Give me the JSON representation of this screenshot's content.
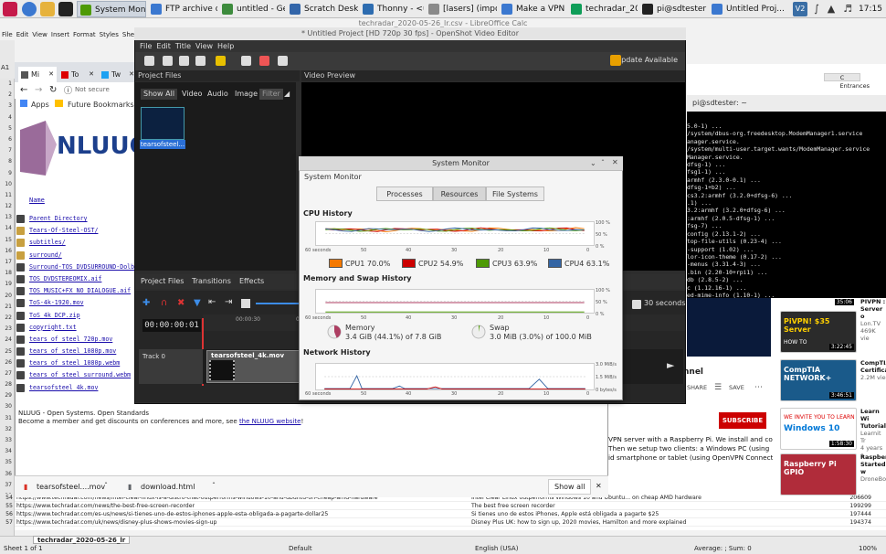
{
  "taskbar": {
    "tasks": [
      {
        "label": "System Monitor",
        "active": true
      },
      {
        "label": "FTP archive di..."
      },
      {
        "label": "untitled - Geany"
      },
      {
        "label": "Scratch Deskt..."
      },
      {
        "label": "Thonny - <un..."
      },
      {
        "label": "[lasers] (impor..."
      },
      {
        "label": "Make a VPN S..."
      },
      {
        "label": "techradar_202..."
      },
      {
        "label": "pi@sdtester: ~"
      },
      {
        "label": "Untitled Proj..."
      }
    ],
    "clock": "17:15"
  },
  "calc": {
    "title": "techradar_2020-05-26_lr.csv - LibreOffice Calc",
    "menu": [
      "File",
      "Edit",
      "View",
      "Insert",
      "Format",
      "Styles",
      "Sheet"
    ],
    "cell_ref": "A1",
    "row_numbers": [
      "1",
      "2",
      "3",
      "4",
      "5",
      "6",
      "7",
      "8",
      "9",
      "10",
      "11",
      "12",
      "13",
      "14",
      "15",
      "16",
      "17",
      "18",
      "19",
      "20",
      "21",
      "22",
      "23",
      "24",
      "25",
      "26",
      "27",
      "28",
      "29",
      "30",
      "31",
      "32",
      "33",
      "34",
      "35",
      "36",
      "37",
      "38",
      "39",
      "40"
    ],
    "bottom_row_numbers": [
      "54",
      "55",
      "56",
      "57"
    ],
    "right_cells": [
      "C",
      "Entrances"
    ],
    "rows": [
      {
        "url": "https://www.techradar.com/news/intel-clear-linux-is-a-distro-that-outperforms-windows-10-and-ubuntu-on-cheap-amd-hardware",
        "title": "Intel Clear Linux outperforms Windows 10 and Ubuntu... on cheap AMD hardware",
        "n": "206609"
      },
      {
        "url": "https://www.techradar.com/news/the-best-free-screen-recorder",
        "title": "The best free screen recorder",
        "n": "199299"
      },
      {
        "url": "https://www.techradar.com/es-us/news/si-tienes-uno-de-estos-iphones-apple-esta-obligada-a-pagarte-dollar25",
        "title": "Si tienes uno de estos iPhones, Apple está obligada a pagarte $25",
        "n": "197444"
      },
      {
        "url": "https://www.techradar.com/uk/news/disney-plus-shows-movies-sign-up",
        "title": "Disney Plus UK: how to sign up, 2020 movies, Hamilton and more explained",
        "n": "194374"
      }
    ],
    "upper_right_rows": [
      {
        "title": "ccess – here's how to get it",
        "n": "204292"
      },
      {
        "title": "iones we've tested",
        "n": "200689"
      }
    ],
    "status": {
      "sheet": "Sheet 1 of 1",
      "tab": "techradar_2020-05-26_lr",
      "style": "Default",
      "lang": "English (USA)",
      "sum": "Average: ; Sum: 0",
      "zoom": "100%"
    }
  },
  "chrome": {
    "tabs": [
      "Mi",
      "To",
      "Tw"
    ],
    "url": "Not secure",
    "bookmarks": [
      "Apps",
      "Future Bookmarks"
    ],
    "logo_text": "NLUUG",
    "name_col": "Name",
    "files": [
      "Parent Directory",
      "Tears-Of-Steel-OST/",
      "subtitles/",
      "surround/",
      "Surround-TOS_DVDSURROUND-Dolb",
      "TOS_DVDSTEREOMIX.aif",
      "TOS_MUSIC+FX_NO_DIALOGUE.aif",
      "ToS-4k-1920.mov",
      "ToS_4k_DCP.zip",
      "copyright.txt",
      "tears_of_steel_720p.mov",
      "tears_of_steel_1080p.mov",
      "tears_of_steel_1080p.webm",
      "tears_of_steel_surround.webm",
      "tearsofsteel_4k.mov"
    ],
    "footer_line1": "NLUUG - Open Systems. Open Standards",
    "footer_line2": "Become a member and get discounts on conferences and more, see",
    "footer_link": "the NLUUG website",
    "footer_end": "!",
    "downloads": [
      "tearsofsteel....mov",
      "download.html"
    ],
    "show_all": "Show all"
  },
  "terminal": {
    "title": "pi@sdtester: ~",
    "lines": [
      "5.0-1) ...",
      "/system/dbus-org.freedesktop.ModemManager1.service",
      "anager.service.",
      "/system/multi-user.target.wants/ModemManager.service",
      "Manager.service.",
      "dfsg-1) ...",
      "fsg1-1) ...",
      "armhf (2.3.0-0.1) ...",
      "dfsg-1+b2) ...",
      "cs3.2:armhf (3.2.0+dfsg-6) ...",
      ".1) ...",
      "3.2:armhf (3.2.0+dfsg-6) ...",
      ":armhf (2.0.5-dfsg-1) ...",
      "fsg-7) ...",
      "config (2.13.1-2) ...",
      "top-file-utils (0.23-4) ...",
      "-support (1.02) ...",
      "lor-icon-theme (0.17-2) ...",
      "-menus (3.31.4-3) ...",
      ".bin (2.20-10+rpi1) ...",
      "db (2.8.5-2) ...",
      "c (1.12.16-1) ...",
      "ed-mime-info (1.10-1) ..."
    ]
  },
  "youtube": {
    "channel_word": "nnel",
    "share": "SHARE",
    "save": "SAVE",
    "subscribe": "SUBSCRIBE",
    "desc": [
      "VPN server with a Raspberry Pi. We install and configure",
      "Then we setup two clients: a Windows PC (using",
      "id smartphone or tablet (using OpenVPN Connect and"
    ],
    "videos": [
      {
        "dur": "3:22:45",
        "title": "PIVPN : Server o",
        "meta": "Lon.TV",
        "views": "469K vie",
        "banner": "PiVPN! $35 Server",
        "sub": "HOW TO"
      },
      {
        "dur": "3:46:51",
        "title": "CompTIA Certifica",
        "meta": "",
        "views": "2.2M vie",
        "banner": "CompTIA NETWORK+",
        "sub": ""
      },
      {
        "dur": "1:58:30",
        "title": "Learn Wi Tutorial",
        "meta": "Learnit Tr",
        "views": "4 years s",
        "banner": "Windows 10",
        "sub": "WE INVITE YOU TO LEARN"
      },
      {
        "dur": "",
        "title": "Raspberr Started w",
        "meta": "DroneBot",
        "views": "",
        "banner": "Raspberry Pi GPIO",
        "sub": ""
      }
    ],
    "first_dur": "35:06"
  },
  "openshot": {
    "title": "* Untitled Project [HD 720p 30 fps] - OpenShot Video Editor",
    "menu": [
      "File",
      "Edit",
      "Title",
      "View",
      "Help"
    ],
    "update": "Update Available",
    "project_files": "Project Files",
    "video_preview": "Video Preview",
    "filter_tabs": [
      "Show All",
      "Video",
      "Audio",
      "Image",
      "Filter"
    ],
    "clip_label": "tearsofsteel...",
    "lower_tabs": [
      "Project Files",
      "Transitions",
      "Effects"
    ],
    "timecode": "00:00:00:01",
    "ruler": [
      "00:00:30",
      "00:01:00",
      "00:01:30",
      "00:02:00",
      "00:02:30",
      "00:03:00",
      "00:03:30"
    ],
    "zoom": "30 seconds",
    "track": "Track 0",
    "clip": "tearsofsteel_4k.mov"
  },
  "sysmon": {
    "window_title": "System Monitor",
    "app_title": "System Monitor",
    "tabs": [
      "Processes",
      "Resources",
      "File Systems"
    ],
    "selected_tab": "Resources",
    "cpu_title": "CPU History",
    "mem_title": "Memory and Swap History",
    "net_title": "Network History",
    "time_axis": [
      "60 seconds",
      "50",
      "40",
      "30",
      "20",
      "10",
      "0"
    ],
    "pct_axis": [
      "100 %",
      "50 %",
      "0 %"
    ],
    "net_axis": [
      "3.0 MiB/s",
      "1.5 MiB/s",
      "0 bytes/s"
    ],
    "cpus": [
      {
        "label": "CPU1",
        "value": "70.0%",
        "color": "#f57900"
      },
      {
        "label": "CPU2",
        "value": "54.9%",
        "color": "#cc0000"
      },
      {
        "label": "CPU3",
        "value": "63.9%",
        "color": "#4e9a06"
      },
      {
        "label": "CPU4",
        "value": "63.1%",
        "color": "#3465a4"
      }
    ],
    "memory": {
      "label": "Memory",
      "value": "3.4 GiB (44.1%) of 7.8 GiB",
      "fraction": 0.441,
      "color": "#ad3e62"
    },
    "swap": {
      "label": "Swap",
      "value": "3.0 MiB (3.0%) of 100.0 MiB",
      "fraction": 0.03,
      "color": "#4e9a06"
    }
  }
}
